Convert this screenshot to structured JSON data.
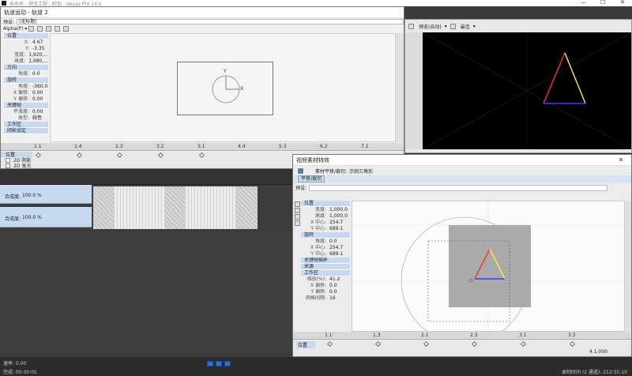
{
  "host_title": "未命名 - 预览工程 - 附加 - Vegas Pro 14.0",
  "left_window": {
    "title": "轨道运动 - 轨道 2",
    "preset_label": "预设:",
    "preset_value": "(无标题)",
    "mode_label": "Alpha(P)",
    "sections": [
      {
        "name": "位置",
        "rows": [
          {
            "k": "X:",
            "v": "4.67"
          },
          {
            "k": "Y:",
            "v": "-3.35"
          },
          {
            "k": "宽度:",
            "v": "1,920,..."
          },
          {
            "k": "高度:",
            "v": "1,080,..."
          }
        ]
      },
      {
        "name": "方向",
        "rows": [
          {
            "k": "角度:",
            "v": "0.0"
          }
        ]
      },
      {
        "name": "旋转",
        "rows": [
          {
            "k": "角度:",
            "v": "-360.0"
          },
          {
            "k": "X 偏移:",
            "v": "0.00"
          },
          {
            "k": "Y 偏移:",
            "v": "0.00"
          }
        ]
      },
      {
        "name": "关键帧",
        "rows": [
          {
            "k": "平滑度:",
            "v": "0.00"
          },
          {
            "k": "类型:",
            "v": "线性"
          }
        ]
      },
      {
        "name": "工作区",
        "rows": []
      },
      {
        "name": "阴影设定",
        "rows": []
      }
    ],
    "axis_y": "Y",
    "axis_x": "X",
    "ruler_ticks": [
      "1.1",
      "1.4",
      "2.3",
      "3.2",
      "3.1",
      "4.4",
      "5.3",
      "6.2",
      "7.1"
    ],
    "track_labels": [
      "位置",
      "2D 阴影",
      "2D 发光"
    ]
  },
  "preview": {
    "mode_label": "预览(自动)",
    "quality_label": "最佳",
    "triangle_colors": [
      "#ff3030",
      "#ffee33",
      "#3a3aff"
    ]
  },
  "timeline": {
    "tracks": [
      {
        "label": "合成度:",
        "value": "100.0 %"
      },
      {
        "label": "合成度:",
        "value": "100.0 %"
      }
    ],
    "rate_label": "速率: 0.00",
    "time_label": "完成: 00:00:01"
  },
  "fx_window": {
    "title": "视频素材特效",
    "chain_label": "素材平移/裁切:",
    "chain_value": "示例三角形",
    "tab_label": "平移/裁切",
    "preset_label": "预设:",
    "sections": [
      {
        "name": "位置",
        "rows": [
          {
            "k": "宽度:",
            "v": "1,000.0"
          },
          {
            "k": "高度:",
            "v": "1,000.0"
          },
          {
            "k": "X 中心:",
            "v": "254.7"
          },
          {
            "k": "Y 中心:",
            "v": "689.1"
          }
        ]
      },
      {
        "name": "旋转",
        "rows": [
          {
            "k": "角度:",
            "v": "0.0"
          },
          {
            "k": "X 中心:",
            "v": "254.7"
          },
          {
            "k": "Y 中心:",
            "v": "689.1"
          }
        ]
      },
      {
        "name": "关键帧插补",
        "rows": []
      },
      {
        "name": "来源",
        "rows": []
      },
      {
        "name": "工作区",
        "rows": [
          {
            "k": "缩放(%):",
            "v": "41.2"
          },
          {
            "k": "X 偏移:",
            "v": "0.0"
          },
          {
            "k": "Y 偏移:",
            "v": "0.0"
          },
          {
            "k": "网格间隔:",
            "v": "16"
          }
        ]
      }
    ],
    "ruler_ticks": [
      "1.1",
      "1.3",
      "2.1",
      "2.3",
      "3.1",
      "3.3"
    ],
    "position_label": "位置",
    "end_time": "4.1.000"
  },
  "statusbar": {
    "record_time": "录制时间 (2 通道): 212:55:10"
  }
}
